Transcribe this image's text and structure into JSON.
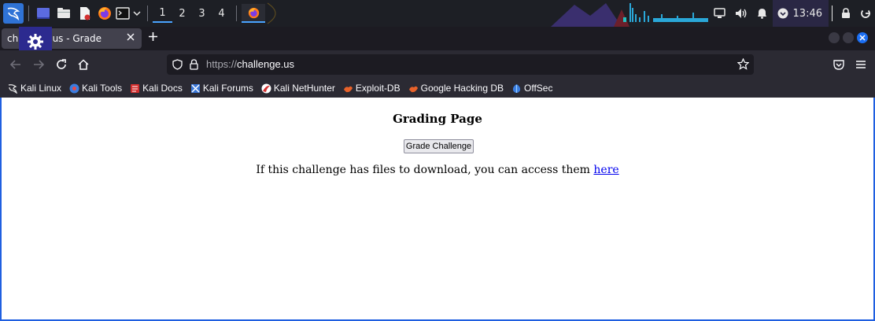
{
  "panel": {
    "workspaces": [
      "1",
      "2",
      "3",
      "4"
    ],
    "clock": "13:46"
  },
  "browser": {
    "tab_title_prefix": "cha",
    "tab_title_suffix": "us - Grade",
    "url_scheme": "https://",
    "url_host": "challenge.us"
  },
  "bookmarks": [
    {
      "label": "Kali Linux",
      "icon": "kali-dragon-icon"
    },
    {
      "label": "Kali Tools",
      "icon": "kali-tools-icon"
    },
    {
      "label": "Kali Docs",
      "icon": "kali-docs-icon"
    },
    {
      "label": "Kali Forums",
      "icon": "kali-forums-icon"
    },
    {
      "label": "Kali NetHunter",
      "icon": "nethunter-icon"
    },
    {
      "label": "Exploit-DB",
      "icon": "exploit-db-icon"
    },
    {
      "label": "Google Hacking DB",
      "icon": "ghdb-icon"
    },
    {
      "label": "OffSec",
      "icon": "offsec-icon"
    }
  ],
  "page": {
    "heading": "Grading Page",
    "button_label": "Grade Challenge",
    "download_text": "If this challenge has files to download, you can access them ",
    "download_link": "here"
  },
  "colors": {
    "panel_bg": "#1d1f25",
    "accent": "#1b6ef3",
    "link": "#0000ee"
  }
}
